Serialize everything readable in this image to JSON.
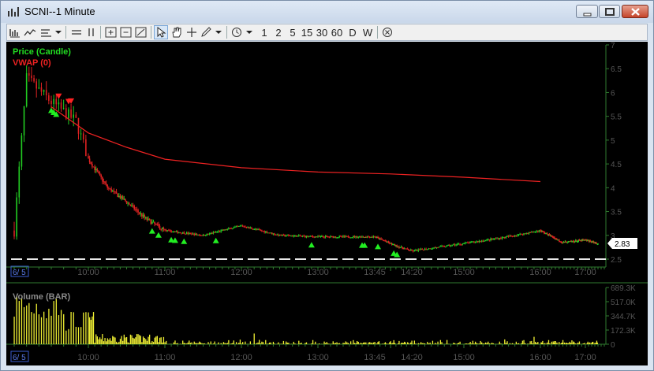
{
  "window": {
    "title": "SCNI--1 Minute"
  },
  "toolbar": {
    "timeframes": [
      "1",
      "2",
      "5",
      "15",
      "30",
      "60",
      "D",
      "W"
    ]
  },
  "indicators": {
    "price_label": "Price (Candle)",
    "vwap_label": "VWAP (0)",
    "volume_label": "Volume (BAR)"
  },
  "colors": {
    "background": "#000000",
    "price_label": "#22dd22",
    "vwap": "#ee2222",
    "up_candle": "#22cc22",
    "down_candle": "#dd2222",
    "volume_bar": "#eeee33",
    "axis": "#2f7a2f",
    "grid": "#154515",
    "last_price_tag": "#ffffff"
  },
  "icons": [
    "chart-bar-icon",
    "minimize-icon",
    "maximize-icon",
    "close-icon",
    "cursor-icon",
    "hand-icon",
    "crosshair-icon",
    "pencil-icon",
    "clock-icon",
    "cancel-icon"
  ],
  "date_marker": "6/ 5",
  "last_price_tag": "2.83",
  "chart_data": {
    "type": "candlestick",
    "x_ticks": [
      "10:00",
      "11:00",
      "12:00",
      "13:00",
      "13:45",
      "14:20",
      "15:00",
      "16:00",
      "17:00"
    ],
    "price_axis": {
      "ticks": [
        "7",
        "6.5",
        "6",
        "5.5",
        "5",
        "4.5",
        "4",
        "3.5",
        "3",
        "2.5"
      ],
      "range": [
        2.5,
        7
      ]
    },
    "volume_axis": {
      "ticks": [
        "689.3K",
        "517.0K",
        "344.7K",
        "172.3K",
        "0"
      ],
      "range": [
        0,
        689300
      ]
    },
    "price_series": [
      {
        "t": "9:30",
        "price": 3.1
      },
      {
        "t": "9:35",
        "price": 6.3
      },
      {
        "t": "9:45",
        "price": 5.8
      },
      {
        "t": "9:55",
        "price": 5.4
      },
      {
        "t": "10:00",
        "price": 4.6
      },
      {
        "t": "10:15",
        "price": 4.0
      },
      {
        "t": "10:30",
        "price": 3.7
      },
      {
        "t": "10:45",
        "price": 3.35
      },
      {
        "t": "11:00",
        "price": 3.1
      },
      {
        "t": "11:30",
        "price": 3.0
      },
      {
        "t": "12:00",
        "price": 3.2
      },
      {
        "t": "12:30",
        "price": 3.0
      },
      {
        "t": "13:00",
        "price": 2.97
      },
      {
        "t": "13:45",
        "price": 2.97
      },
      {
        "t": "14:05",
        "price": 2.78
      },
      {
        "t": "14:20",
        "price": 2.67
      },
      {
        "t": "15:00",
        "price": 2.83
      },
      {
        "t": "15:30",
        "price": 2.95
      },
      {
        "t": "16:00",
        "price": 3.1
      },
      {
        "t": "16:30",
        "price": 2.85
      },
      {
        "t": "17:00",
        "price": 2.9
      },
      {
        "t": "17:20",
        "price": 2.83
      }
    ],
    "vwap_series": [
      {
        "t": "9:45",
        "price": 5.7
      },
      {
        "t": "10:00",
        "price": 5.15
      },
      {
        "t": "10:30",
        "price": 4.85
      },
      {
        "t": "11:00",
        "price": 4.6
      },
      {
        "t": "12:00",
        "price": 4.42
      },
      {
        "t": "13:00",
        "price": 4.33
      },
      {
        "t": "14:00",
        "price": 4.29
      },
      {
        "t": "15:00",
        "price": 4.22
      },
      {
        "t": "16:00",
        "price": 4.13
      }
    ]
  }
}
